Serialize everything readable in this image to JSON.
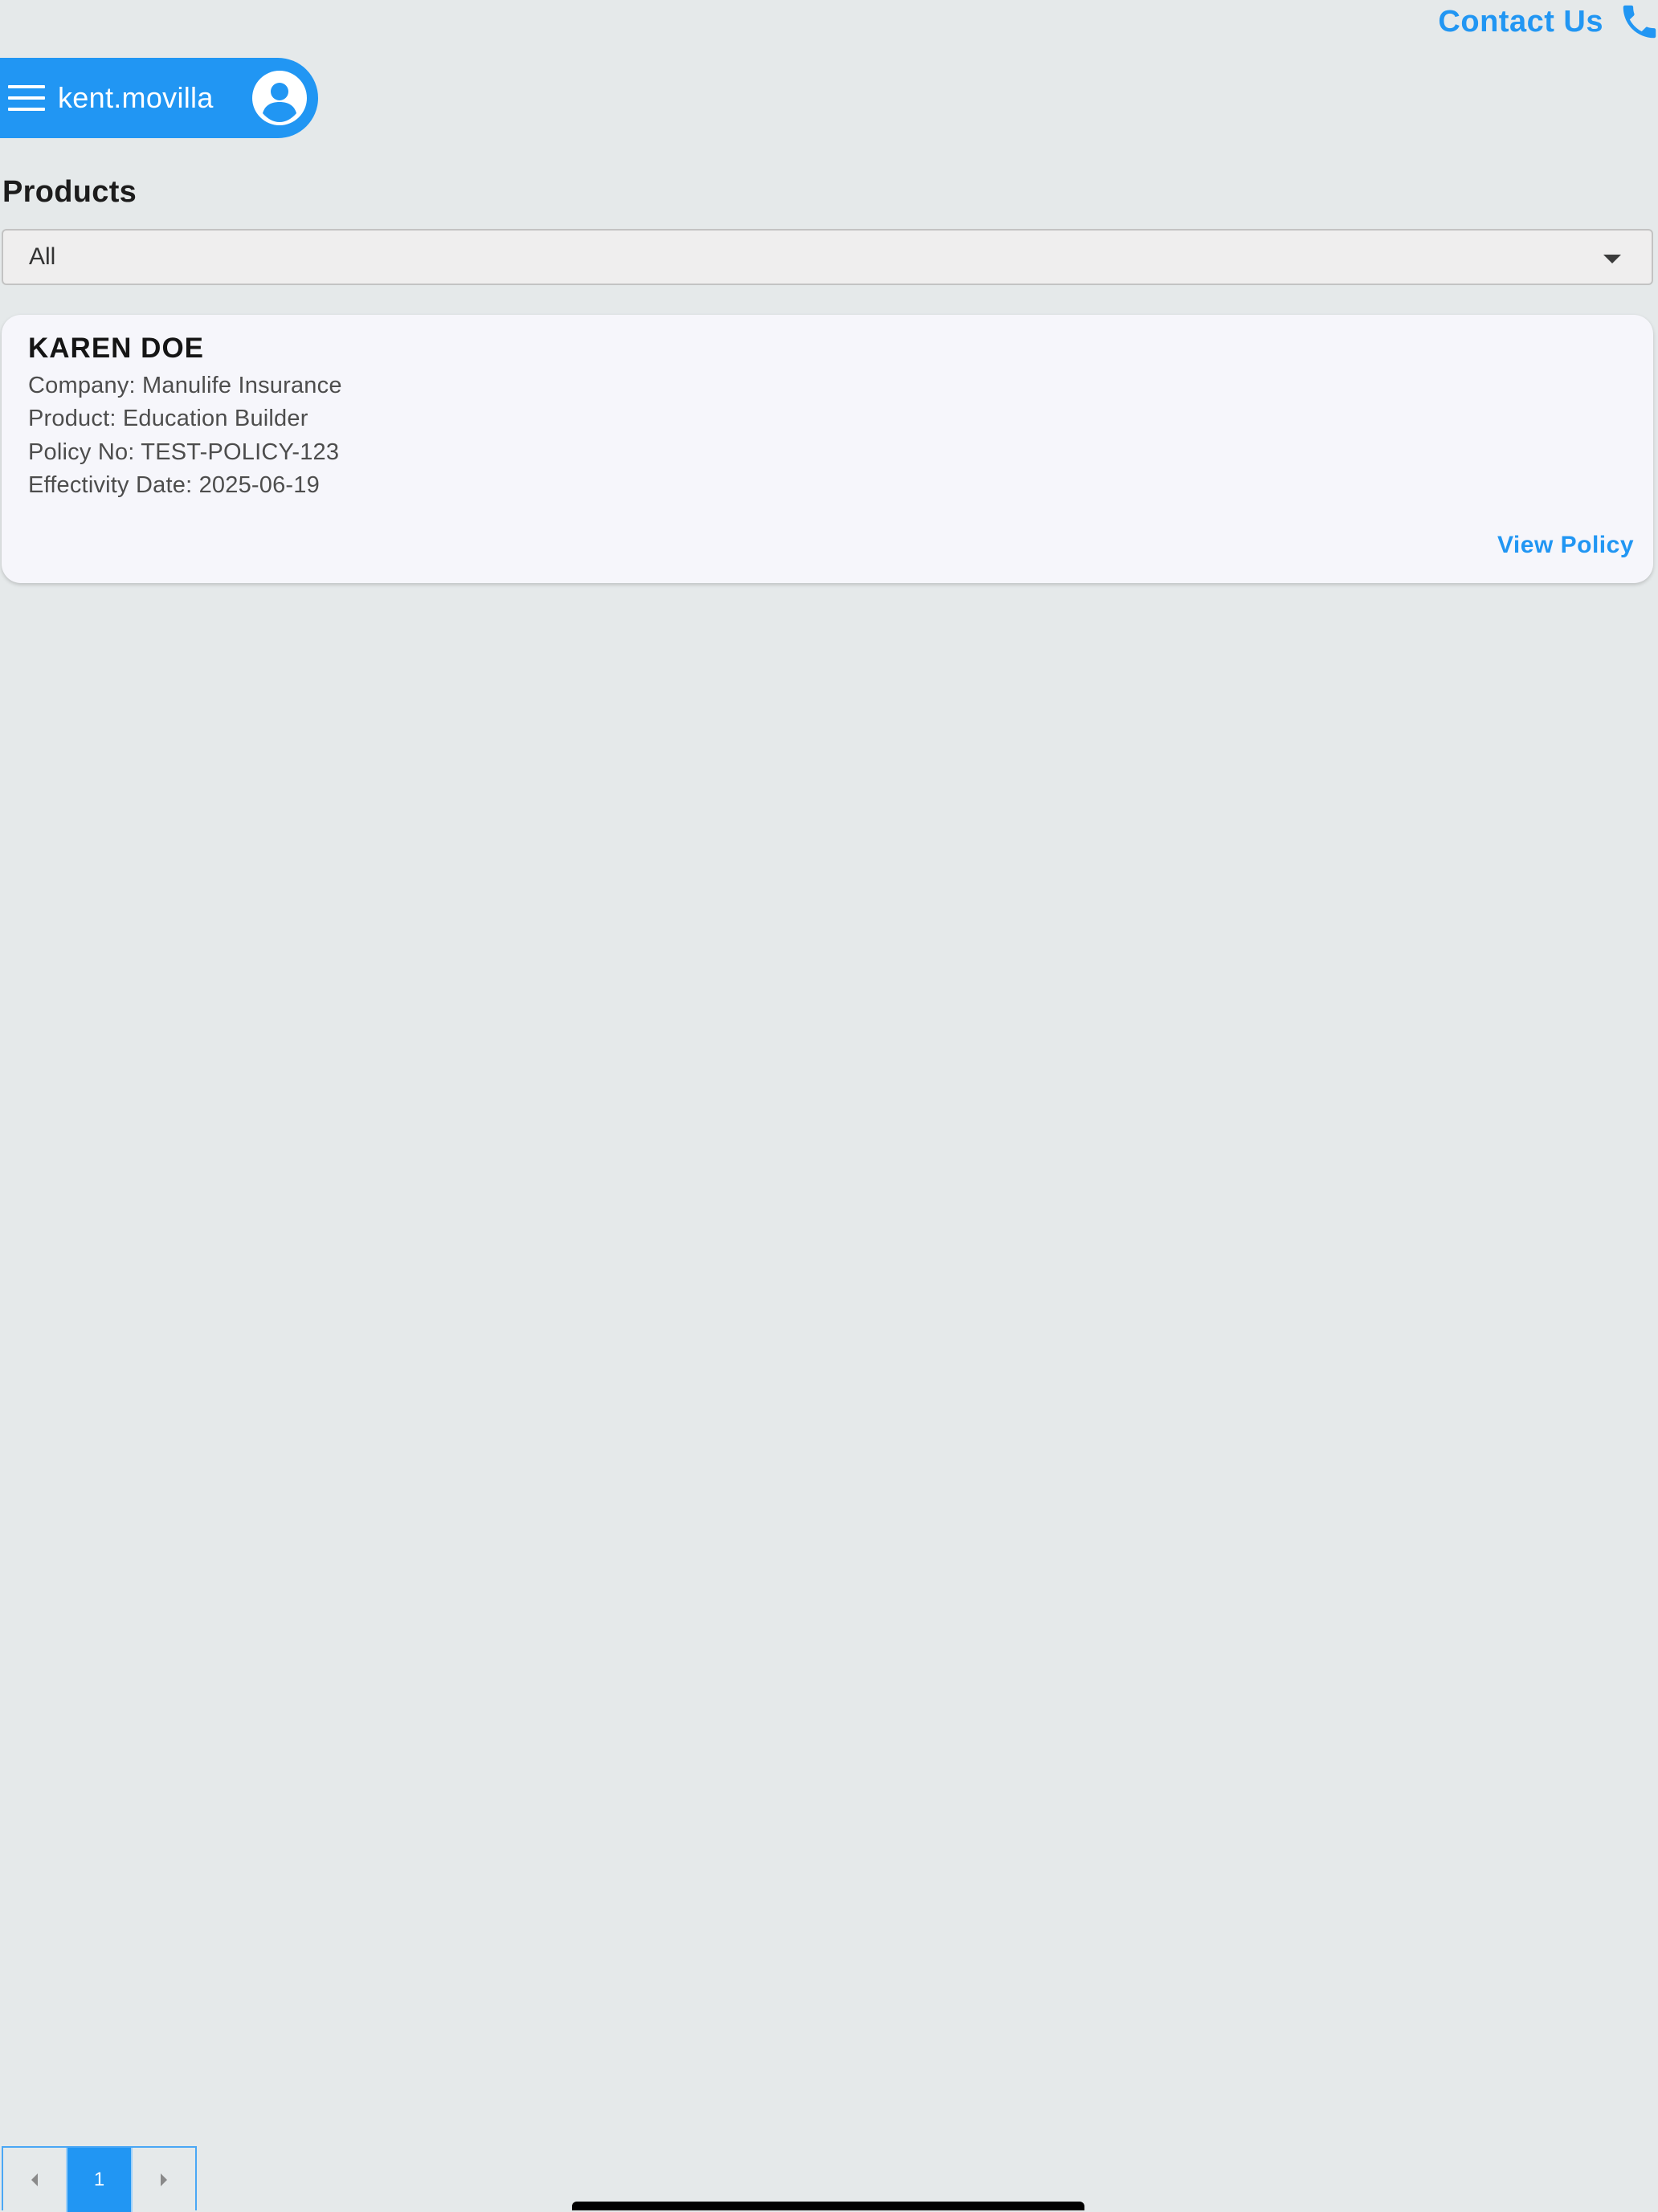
{
  "header": {
    "contact_label": "Contact Us",
    "contact_icon": "phone-icon",
    "username": "kent.movilla",
    "menu_icon": "hamburger-menu-icon",
    "avatar_icon": "user-avatar-icon"
  },
  "products": {
    "title": "Products",
    "filter": {
      "selected": "All",
      "caret_icon": "caret-down-icon"
    }
  },
  "policies": [
    {
      "holder_name": "KAREN DOE",
      "company": "Company: Manulife Insurance",
      "product": "Product: Education Builder",
      "policy_no": "Policy No: TEST-POLICY-123",
      "effectivity_date": "Effectivity Date: 2025-06-19",
      "action_label": "View Policy"
    }
  ],
  "pagination": {
    "current_page": "1",
    "prev_icon": "arrow-left-icon",
    "next_icon": "arrow-right-icon"
  },
  "colors": {
    "accent": "#2196f3",
    "background": "#e5e9ea",
    "card": "#f6f6fb"
  }
}
